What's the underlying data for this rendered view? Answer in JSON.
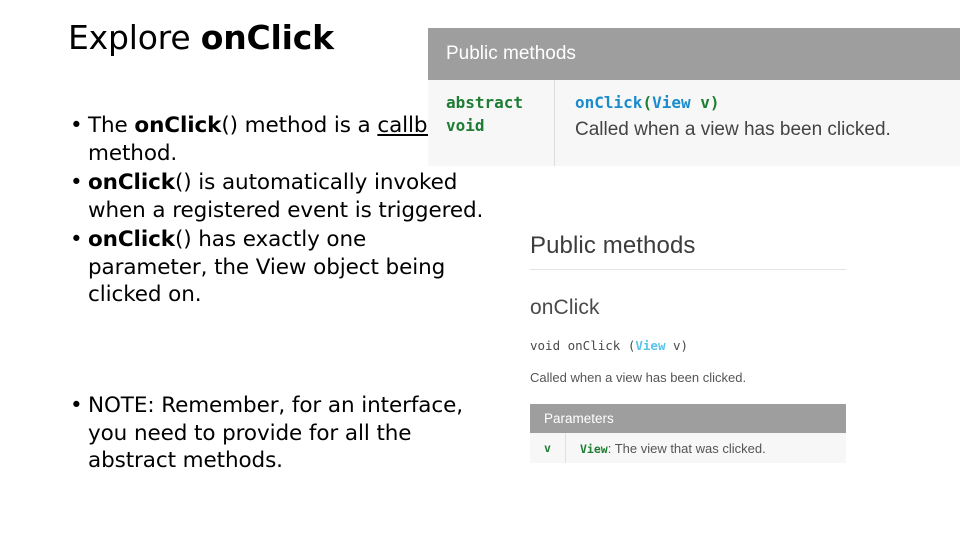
{
  "slide": {
    "title_prefix": "Explore ",
    "title_emphasis": "onClick",
    "bullets": [
      {
        "segments": [
          {
            "text": "The ",
            "style": "normal"
          },
          {
            "text": "onClick",
            "style": "bold"
          },
          {
            "text": "() method is a ",
            "style": "normal"
          },
          {
            "text": "callback",
            "style": "underline"
          },
          {
            "text": " method.",
            "style": "normal"
          }
        ]
      },
      {
        "segments": [
          {
            "text": "onClick",
            "style": "bold"
          },
          {
            "text": "() is automatically invoked when a registered event is triggered.",
            "style": "normal"
          }
        ]
      },
      {
        "segments": [
          {
            "text": "onClick",
            "style": "bold"
          },
          {
            "text": "() has exactly one parameter, the View object being clicked on.",
            "style": "normal"
          }
        ]
      }
    ],
    "note_bullet": {
      "segments": [
        {
          "text": "NOTE: Remember, for an interface, you need to provide for all the abstract methods.",
          "style": "normal"
        }
      ]
    }
  },
  "doc_panel": {
    "header_label": "Public methods",
    "modifier_line1": "abstract",
    "modifier_line2": "void",
    "signature": {
      "method": "onClick",
      "open_paren": "(",
      "param_type": "View",
      "space": " ",
      "param_name": "v",
      "close_paren": ")"
    },
    "description": "Called when a view has been clicked."
  },
  "doc_panel2": {
    "title": "Public methods",
    "method_name": "onClick",
    "signature": {
      "return_type": "void",
      "method": " onClick (",
      "param_type": "View",
      "param_name": " v)"
    },
    "description": "Called when a view has been clicked.",
    "params_header": "Parameters",
    "param_rows": [
      {
        "name": "v",
        "type": "View",
        "description": ": The view that was clicked."
      }
    ]
  },
  "colors": {
    "header_gray": "#9e9e9e",
    "panel_bg": "#f7f7f7",
    "code_green": "#1e7d32",
    "code_blue": "#1b8ccb",
    "code_lightblue": "#59c3e8"
  }
}
